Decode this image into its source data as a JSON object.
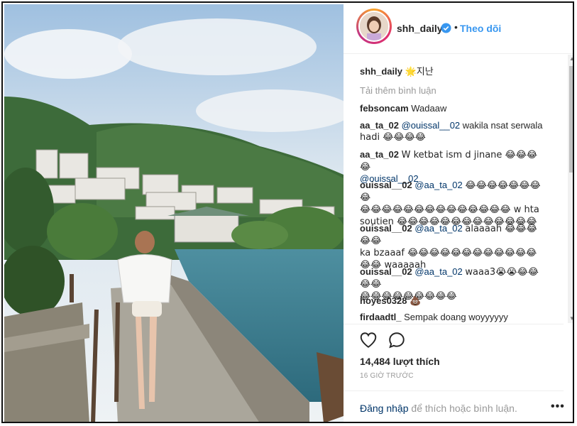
{
  "post": {
    "username": "shh_daily",
    "dot": "•",
    "follow_label": "Theo dõi"
  },
  "caption": {
    "user": "shh_daily",
    "text": "🌟지난"
  },
  "load_more": "Tải thêm bình luận",
  "comments": [
    {
      "user": "febsoncam",
      "lines": [
        "Wadaaw"
      ]
    },
    {
      "user": "aa_ta_02",
      "mention": "@ouissal__02",
      "lines": [
        "wakila nsat serwala",
        "hadi 😂😂😂😂"
      ]
    },
    {
      "user": "aa_ta_02",
      "mention": "@ouissal__02",
      "lines": [
        "W ketbat ism d jinane 😂😂😂😂"
      ]
    },
    {
      "user": "ouissal__02",
      "mention": "@aa_ta_02",
      "lines": [
        "😂😂😂😂😂😂😂😂",
        "😂😂😂😂😂😂😂😂😂😂😂😂😂😂 w hta",
        "soutien 😂😂😂😂😂😂😂😂😂😂😂😂😂"
      ]
    },
    {
      "user": "ouissal__02",
      "mention": "@aa_ta_02",
      "lines": [
        "alaaaah 😂😂😂😂😂",
        "ka bzaaaf 😂😂😂😂😂😂😂😂😂😂😂😂",
        "😂😂 waaaaah"
      ]
    },
    {
      "user": "ouissal__02",
      "mention": "@aa_ta_02",
      "lines": [
        "waaa3😭😭😂😂😂😂",
        "😂😂😂😂😂😂😂😂😂"
      ]
    },
    {
      "user": "hoyes0328",
      "lines": [
        "💩"
      ]
    },
    {
      "user": "firdaadtl_",
      "lines": [
        "Sempak doang woyyyyyy"
      ]
    }
  ],
  "likes": "14,484 lượt thích",
  "time": "16 GIỜ TRƯỚC",
  "login": {
    "link": "Đăng nhập",
    "rest": " để thích hoặc bình luận."
  },
  "more": "•••",
  "icons": {
    "verified": "verified-badge-icon",
    "like": "heart-outline-icon",
    "comment": "speech-bubble-icon",
    "more": "more-options-icon"
  },
  "colors": {
    "link": "#3897f0",
    "mention": "#003569",
    "muted": "#999999"
  }
}
